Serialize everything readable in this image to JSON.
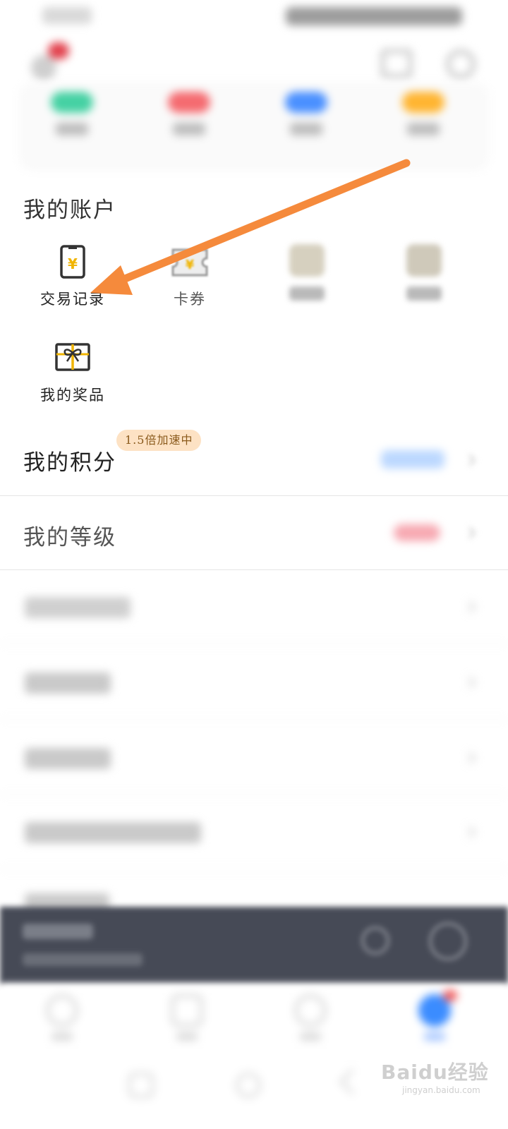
{
  "colors": {
    "accent_orange": "#f58a3c",
    "speed_badge_bg": "#fde2c4",
    "speed_badge_text": "#8a5a1c",
    "player_bg": "#464a56",
    "active_tab": "#3b8cff",
    "icon_gold": "#f0b400"
  },
  "quick_actions": [
    {
      "icon": "green-pill-icon",
      "color": "#45d1a3"
    },
    {
      "icon": "red-pill-icon",
      "color": "#f56b70"
    },
    {
      "icon": "blue-pill-icon",
      "color": "#4a90ff"
    },
    {
      "icon": "yellow-pill-icon",
      "color": "#ffb531"
    }
  ],
  "account": {
    "title": "我的账户",
    "items": [
      {
        "label": "交易记录",
        "icon": "transaction-record-icon"
      },
      {
        "label": "卡券",
        "icon": "coupon-icon"
      },
      {
        "label": "",
        "icon": "blurred-item-icon"
      },
      {
        "label": "",
        "icon": "blurred-item-icon"
      },
      {
        "label": "我的奖品",
        "icon": "gift-box-icon"
      }
    ]
  },
  "points": {
    "title": "我的积分",
    "badge": "1.5倍加速中"
  },
  "level": {
    "title": "我的等级"
  },
  "annotation": {
    "type": "arrow",
    "points_to": "交易记录"
  },
  "watermark": {
    "text": "Baidu经验",
    "sub": "jingyan.baidu.com"
  }
}
